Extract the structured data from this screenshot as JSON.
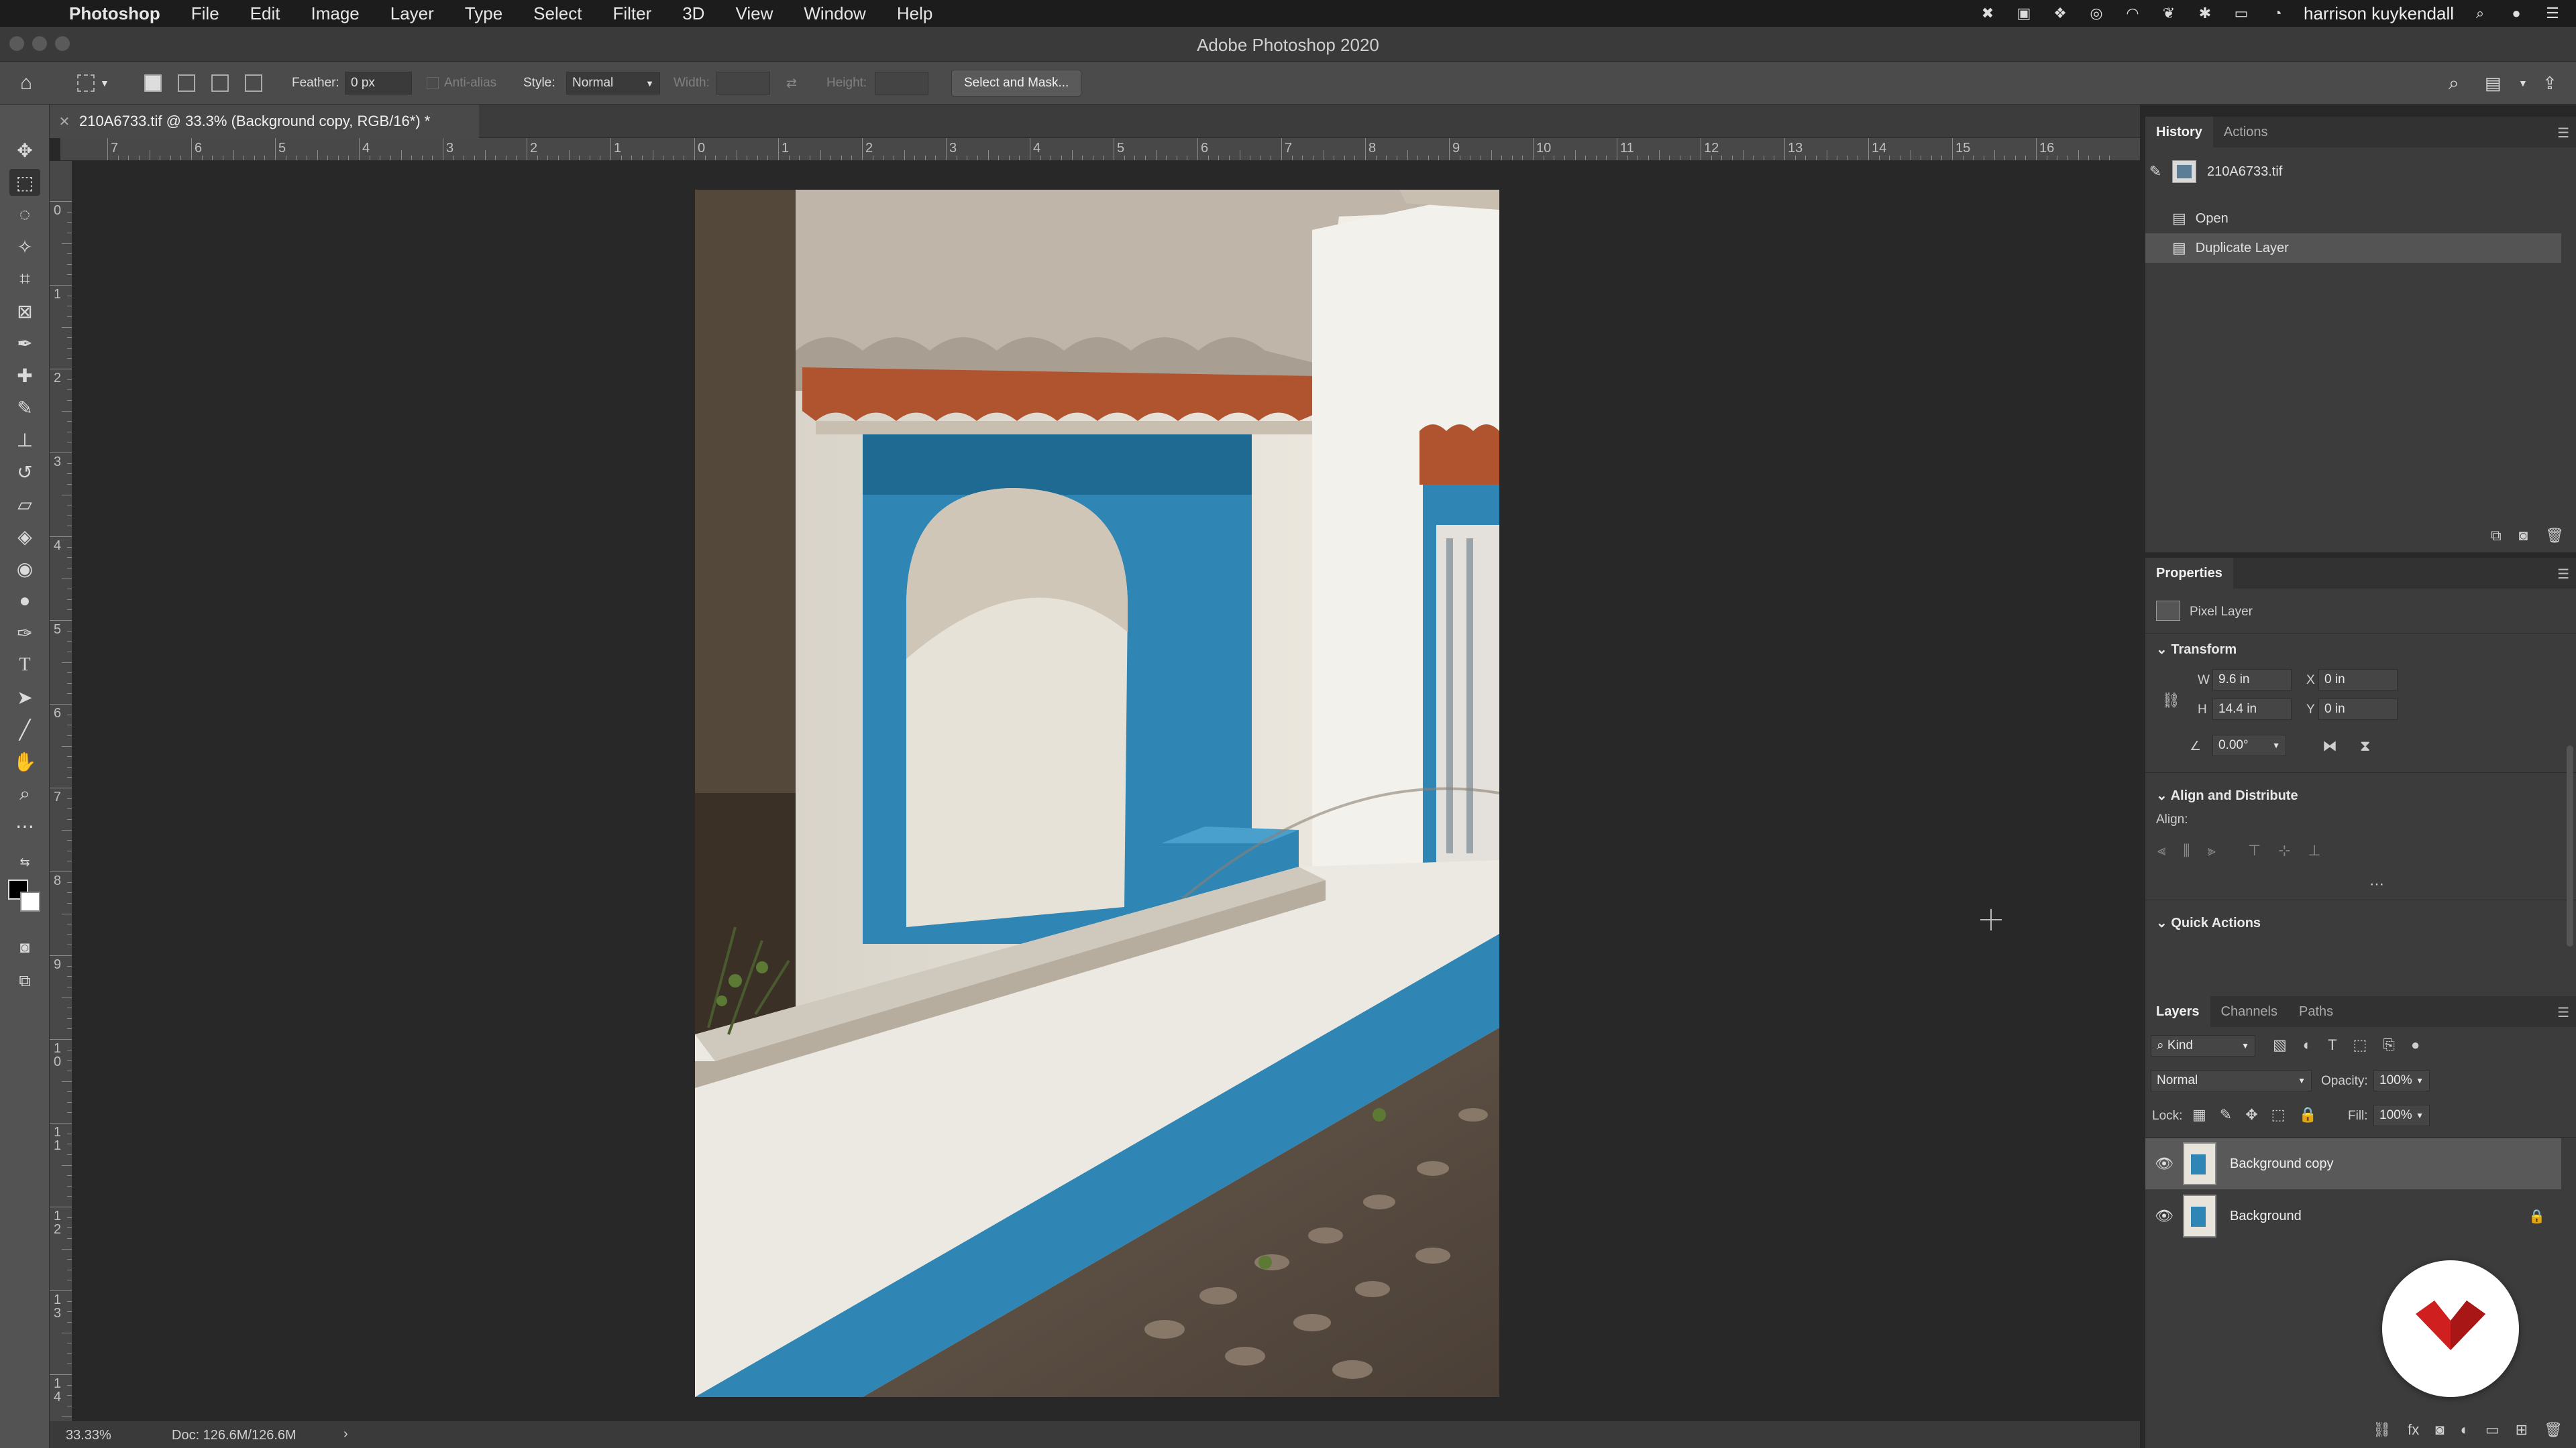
{
  "menubar": {
    "app_name": "Photoshop",
    "items": [
      "File",
      "Edit",
      "Image",
      "Layer",
      "Type",
      "Select",
      "Filter",
      "3D",
      "View",
      "Window",
      "Help"
    ],
    "user": "harrison kuykendall"
  },
  "window": {
    "title": "Adobe Photoshop 2020"
  },
  "options": {
    "feather_label": "Feather:",
    "feather_value": "0 px",
    "antialias_label": "Anti-alias",
    "style_label": "Style:",
    "style_value": "Normal",
    "width_label": "Width:",
    "height_label": "Height:",
    "select_mask_label": "Select and Mask..."
  },
  "document": {
    "tab_title": "210A6733.tif @ 33.3% (Background copy, RGB/16*) *"
  },
  "ruler": {
    "h_labels": [
      "7",
      "6",
      "5",
      "4",
      "3",
      "2",
      "1",
      "0",
      "1",
      "2",
      "3",
      "4",
      "5",
      "6",
      "7",
      "8",
      "9",
      "10",
      "11",
      "12",
      "13",
      "14",
      "15",
      "16"
    ],
    "v_labels": [
      "0",
      "1",
      "2",
      "3",
      "4",
      "5",
      "6",
      "7",
      "8",
      "9",
      "10",
      "11",
      "12",
      "13",
      "14"
    ]
  },
  "status": {
    "zoom": "33.33%",
    "doc": "Doc: 126.6M/126.6M"
  },
  "history": {
    "tabs": [
      "History",
      "Actions"
    ],
    "snapshot": "210A6733.tif",
    "steps": [
      "Open",
      "Duplicate Layer"
    ]
  },
  "properties": {
    "title": "Properties",
    "layer_type": "Pixel Layer",
    "transform_title": "Transform",
    "w_label": "W",
    "w_value": "9.6 in",
    "h_label": "H",
    "h_value": "14.4 in",
    "x_label": "X",
    "x_value": "0 in",
    "y_label": "Y",
    "y_value": "0 in",
    "angle_value": "0.00°",
    "align_title": "Align and Distribute",
    "align_label": "Align:",
    "quick_title": "Quick Actions"
  },
  "layers": {
    "tabs": [
      "Layers",
      "Channels",
      "Paths"
    ],
    "filter_value": "Kind",
    "blend_value": "Normal",
    "opacity_label": "Opacity:",
    "opacity_value": "100%",
    "lock_label": "Lock:",
    "fill_label": "Fill:",
    "fill_value": "100%",
    "items": [
      {
        "name": "Background copy"
      },
      {
        "name": "Background"
      }
    ]
  },
  "colors": {
    "accent_blue": "#2f86b4",
    "badge_red": "#d01f1f",
    "ui_dark": "#282828"
  }
}
